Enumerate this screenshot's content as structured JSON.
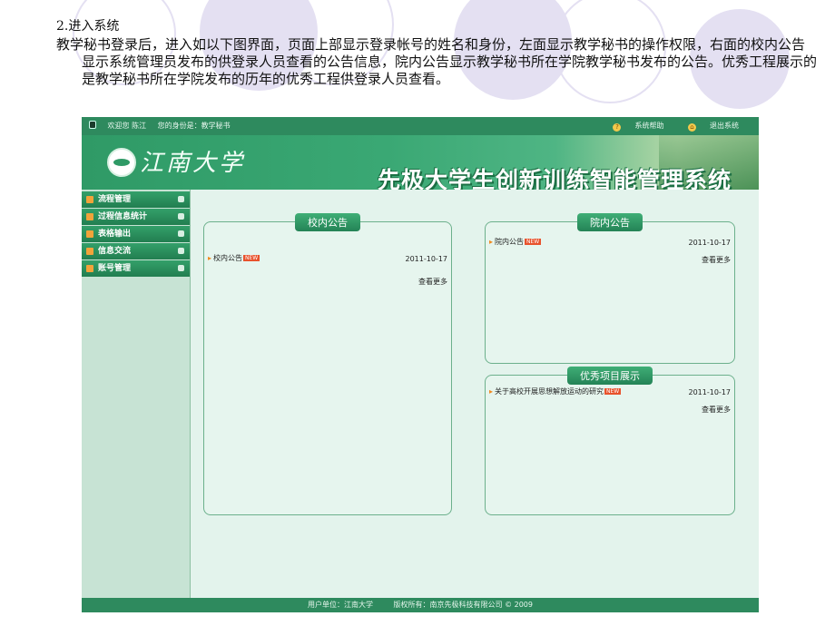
{
  "doc": {
    "heading": "2.进入系统",
    "paragraph": "教学秘书登录后，进入如以下图界面，页面上部显示登录帐号的姓名和身份，左面显示教学秘书的操作权限，右面的校内公告显示系统管理员发布的供登录人员查看的公告信息，院内公告显示教学秘书所在学院教学秘书发布的公告。优秀工程展示的是教学秘书所在学院发布的历年的优秀工程供登录人员查看。"
  },
  "app": {
    "topbar": {
      "welcome": "欢迎您 陈江",
      "identity": "您的身份是：教学秘书",
      "help": "系统帮助",
      "logout": "退出系统"
    },
    "banner": {
      "logo_text": "江南大学",
      "system_title": "先极大学生创新训练智能管理系统"
    },
    "sidebar": {
      "items": [
        {
          "label": "流程管理"
        },
        {
          "label": "过程信息统计"
        },
        {
          "label": "表格输出"
        },
        {
          "label": "信息交流"
        },
        {
          "label": "账号管理"
        }
      ]
    },
    "panels": {
      "school": {
        "title": "校内公告",
        "item": "校内公告",
        "badge": "NEW",
        "date": "2011-10-17",
        "more": "查看更多"
      },
      "college": {
        "title": "院内公告",
        "item": "院内公告",
        "badge": "NEW",
        "date": "2011-10-17",
        "more": "查看更多"
      },
      "projects": {
        "title": "优秀项目展示",
        "item": "关于高校开展思想解放运动的研究",
        "badge": "NEW",
        "date": "2011-10-17",
        "more": "查看更多"
      }
    },
    "footer": {
      "unit": "用户单位：江南大学",
      "copyright": "版权所有：南京先极科技有限公司 © 2009"
    }
  }
}
